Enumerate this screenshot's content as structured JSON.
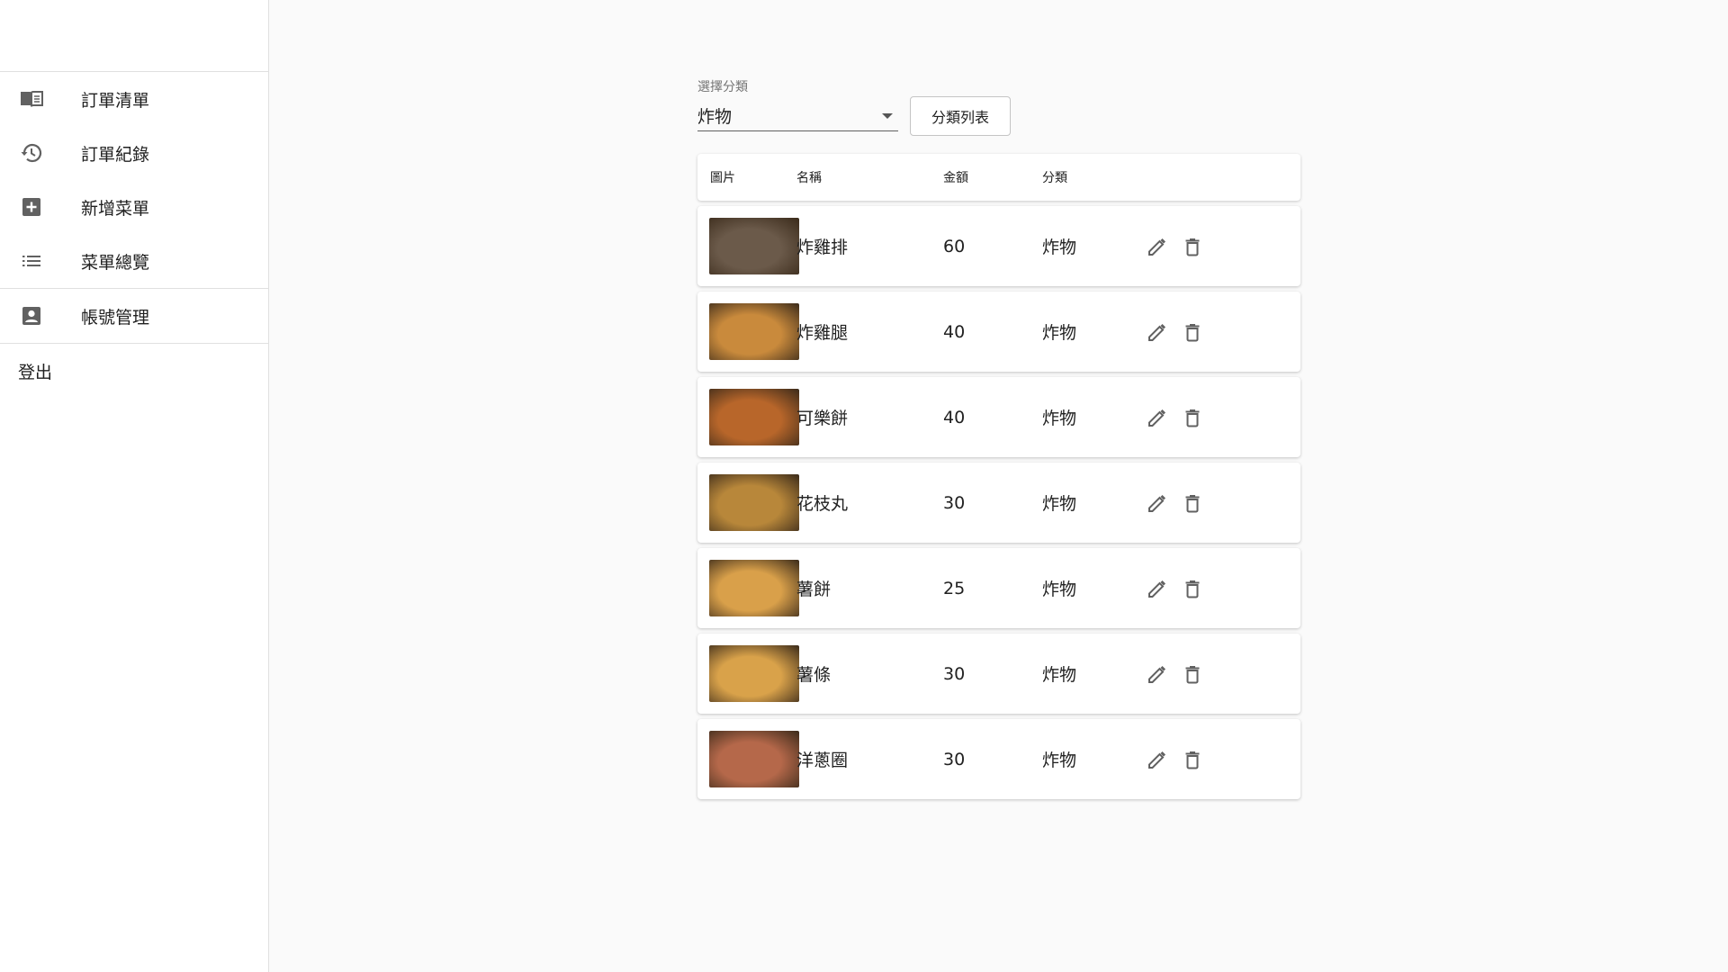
{
  "sidebar": {
    "items": [
      {
        "label": "訂單清單",
        "icon": "menu-book-icon"
      },
      {
        "label": "訂單紀錄",
        "icon": "history-icon"
      },
      {
        "label": "新增菜單",
        "icon": "add-box-icon"
      },
      {
        "label": "菜單總覽",
        "icon": "list-icon"
      }
    ],
    "account": {
      "label": "帳號管理",
      "icon": "account-box-icon"
    },
    "logout_label": "登出"
  },
  "filter": {
    "label": "選擇分類",
    "value": "炸物",
    "button_label": "分類列表"
  },
  "table": {
    "headers": {
      "image": "圖片",
      "name": "名稱",
      "price": "金額",
      "category": "分類"
    },
    "rows": [
      {
        "name": "炸雞排",
        "price": "60",
        "category": "炸物",
        "thumb_color": "#6b5a4a"
      },
      {
        "name": "炸雞腿",
        "price": "40",
        "category": "炸物",
        "thumb_color": "#c98a3c"
      },
      {
        "name": "可樂餅",
        "price": "40",
        "category": "炸物",
        "thumb_color": "#b8662a"
      },
      {
        "name": "花枝丸",
        "price": "30",
        "category": "炸物",
        "thumb_color": "#b8873a"
      },
      {
        "name": "薯餅",
        "price": "25",
        "category": "炸物",
        "thumb_color": "#d9a04a"
      },
      {
        "name": "薯條",
        "price": "30",
        "category": "炸物",
        "thumb_color": "#d9a24a"
      },
      {
        "name": "洋蔥圈",
        "price": "30",
        "category": "炸物",
        "thumb_color": "#b5684a"
      }
    ]
  },
  "colors": {
    "icon": "#616161",
    "border": "#e0e0e0",
    "background": "#fafafa"
  }
}
